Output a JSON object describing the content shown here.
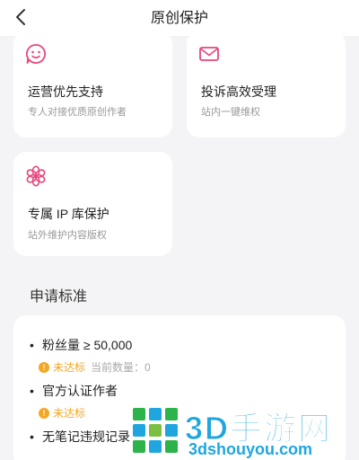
{
  "header": {
    "title": "原创保护",
    "back_icon": "chevron-left-icon"
  },
  "features": [
    {
      "icon": "smiley-chat-icon",
      "title": "运营优先支持",
      "subtitle": "专人对接优质原创作者"
    },
    {
      "icon": "envelope-icon",
      "title": "投诉高效受理",
      "subtitle": "站内一键维权"
    },
    {
      "icon": "flower-icon",
      "title": "专属 IP 库保护",
      "subtitle": "站外维护内容版权"
    }
  ],
  "section": {
    "title": "申请标准"
  },
  "requirements": [
    {
      "bullet": "•",
      "label": "粉丝量 ≥ 50,000",
      "status": "未达标",
      "count": "当前数量：0"
    },
    {
      "bullet": "•",
      "label": "官方认证作者",
      "status": "未达标"
    },
    {
      "bullet": "•",
      "label": "无笔记违规记录"
    }
  ],
  "watermark": {
    "brand": "3D手游网",
    "url": "3dshouyou.com"
  },
  "colors": {
    "accent": "#e8467c",
    "warning": "#f5a623",
    "watermark": "#1fa6df",
    "background": "#f4f4f6"
  }
}
